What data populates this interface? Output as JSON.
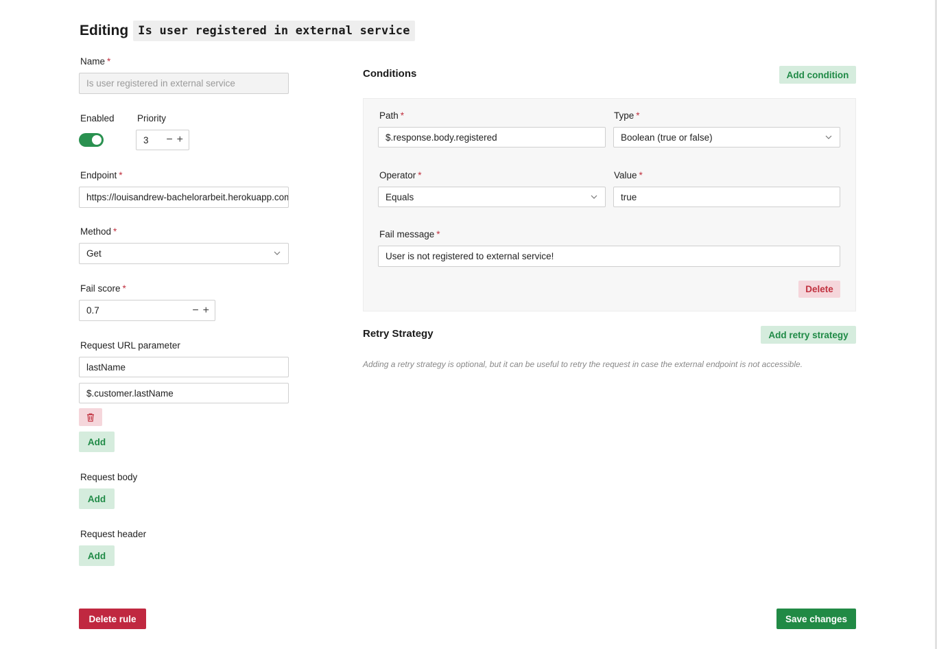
{
  "header": {
    "prefix": "Editing",
    "rule_name": "Is user registered in external service"
  },
  "form": {
    "name": {
      "label": "Name",
      "required_mark": "*",
      "placeholder": "Is user registered in external service"
    },
    "enabled": {
      "label": "Enabled",
      "value": true
    },
    "priority": {
      "label": "Priority",
      "value": "3",
      "minus": "−",
      "plus": "+"
    },
    "endpoint": {
      "label": "Endpoint",
      "required_mark": "*",
      "value": "https://louisandrew-bachelorarbeit.herokuapp.com"
    },
    "method": {
      "label": "Method",
      "required_mark": "*",
      "value": "Get"
    },
    "fail_score": {
      "label": "Fail score",
      "required_mark": "*",
      "value": "0.7",
      "minus": "−",
      "plus": "+"
    },
    "url_param": {
      "label": "Request URL parameter",
      "key": "lastName",
      "value": "$.customer.lastName",
      "add_label": "Add"
    },
    "request_body": {
      "label": "Request body",
      "add_label": "Add"
    },
    "request_header": {
      "label": "Request header",
      "add_label": "Add"
    }
  },
  "conditions": {
    "title": "Conditions",
    "add_label": "Add condition",
    "items": [
      {
        "path_label": "Path",
        "path": "$.response.body.registered",
        "type_label": "Type",
        "type": "Boolean (true or false)",
        "operator_label": "Operator",
        "operator": "Equals",
        "value_label": "Value",
        "value": "true",
        "fail_message_label": "Fail message",
        "fail_message": "User is not registered to external service!",
        "delete_label": "Delete",
        "required_mark": "*"
      }
    ]
  },
  "retry": {
    "title": "Retry Strategy",
    "add_label": "Add retry strategy",
    "hint": "Adding a retry strategy is optional, but it can be useful to retry the request in case the external endpoint is not accessible."
  },
  "footer": {
    "delete_label": "Delete rule",
    "save_label": "Save changes"
  },
  "colors": {
    "accent": "#218a45",
    "danger": "#c02840",
    "light_accent": "#d5ecdd",
    "light_danger": "#f5d6db"
  },
  "icons": {
    "chevron": "chevron-down-icon",
    "trash": "trash-icon"
  }
}
